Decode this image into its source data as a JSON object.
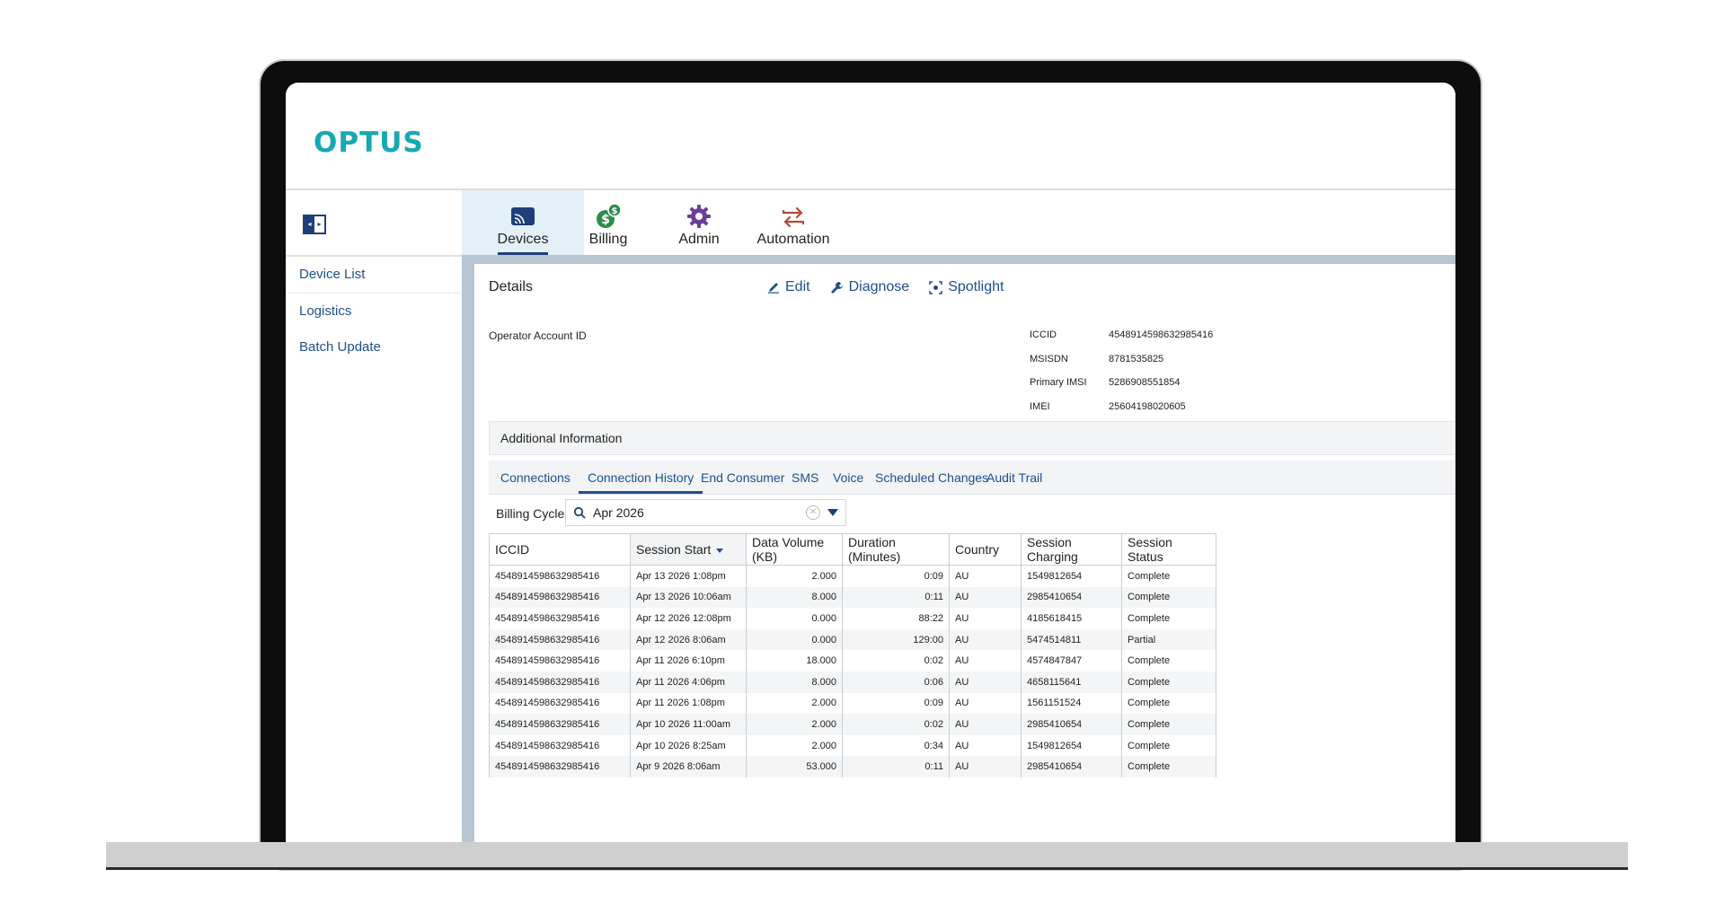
{
  "brand": {
    "logo": "OPTUS",
    "accent": "#17a9b2",
    "primary": "#1f3f7a",
    "link": "#1f4f8f"
  },
  "nav": [
    {
      "label": "Devices",
      "icon": "devices-icon",
      "active": true
    },
    {
      "label": "Billing",
      "icon": "billing-icon"
    },
    {
      "label": "Admin",
      "icon": "gear-icon"
    },
    {
      "label": "Automation",
      "icon": "automation-arrows-icon"
    }
  ],
  "sidebar": {
    "items": [
      {
        "label": "Device List"
      },
      {
        "label": "Logistics"
      },
      {
        "label": "Batch Update"
      }
    ]
  },
  "details": {
    "title": "Details",
    "actions": [
      {
        "label": "Edit",
        "icon": "pencil-icon"
      },
      {
        "label": "Diagnose",
        "icon": "wrench-icon"
      },
      {
        "label": "Spotlight",
        "icon": "spotlight-icon"
      }
    ],
    "operator_account_label": "Operator Account ID",
    "fields": [
      {
        "key": "ICCID",
        "value": "4548914598632985416"
      },
      {
        "key": "MSISDN",
        "value": "8781535825"
      },
      {
        "key": "Primary IMSI",
        "value": "5286908551854"
      },
      {
        "key": "IMEI",
        "value": "25604198020605"
      }
    ]
  },
  "additional_info": {
    "title": "Additional Information"
  },
  "tabs": [
    {
      "label": "Connections"
    },
    {
      "label": "Connection History",
      "active": true
    },
    {
      "label": "End Consumer"
    },
    {
      "label": "SMS"
    },
    {
      "label": "Voice"
    },
    {
      "label": "Scheduled Changes"
    },
    {
      "label": "Audit Trail"
    }
  ],
  "billing": {
    "label": "Billing Cycle:",
    "value": "Apr 2026"
  },
  "table": {
    "columns": [
      "ICCID",
      "Session Start",
      "Data Volume (KB)",
      "Duration (Minutes)",
      "Country",
      "Session Charging",
      "Session Status"
    ],
    "sorted_column": "Session Start",
    "rows": [
      [
        "4548914598632985416",
        "Apr 13 2026 1:08pm",
        "2.000",
        "0:09",
        "AU",
        "1549812654",
        "Complete"
      ],
      [
        "4548914598632985416",
        "Apr 13 2026 10:06am",
        "8.000",
        "0:11",
        "AU",
        "2985410654",
        "Complete"
      ],
      [
        "4548914598632985416",
        "Apr 12 2026 12:08pm",
        "0.000",
        "88:22",
        "AU",
        "4185618415",
        "Complete"
      ],
      [
        "4548914598632985416",
        "Apr 12 2026 8:06am",
        "0.000",
        "129:00",
        "AU",
        "5474514811",
        "Partial"
      ],
      [
        "4548914598632985416",
        "Apr 11 2026 6:10pm",
        "18.000",
        "0:02",
        "AU",
        "4574847847",
        "Complete"
      ],
      [
        "4548914598632985416",
        "Apr 11 2026 4:06pm",
        "8.000",
        "0:06",
        "AU",
        "4658115641",
        "Complete"
      ],
      [
        "4548914598632985416",
        "Apr 11 2026 1:08pm",
        "2.000",
        "0:09",
        "AU",
        "1561151524",
        "Complete"
      ],
      [
        "4548914598632985416",
        "Apr 10 2026 11:00am",
        "2.000",
        "0:02",
        "AU",
        "2985410654",
        "Complete"
      ],
      [
        "4548914598632985416",
        "Apr 10 2026 8:25am",
        "2.000",
        "0:34",
        "AU",
        "1549812654",
        "Complete"
      ],
      [
        "4548914598632985416",
        "Apr 9 2026 8:06am",
        "53.000",
        "0:11",
        "AU",
        "2985410654",
        "Complete"
      ]
    ]
  }
}
